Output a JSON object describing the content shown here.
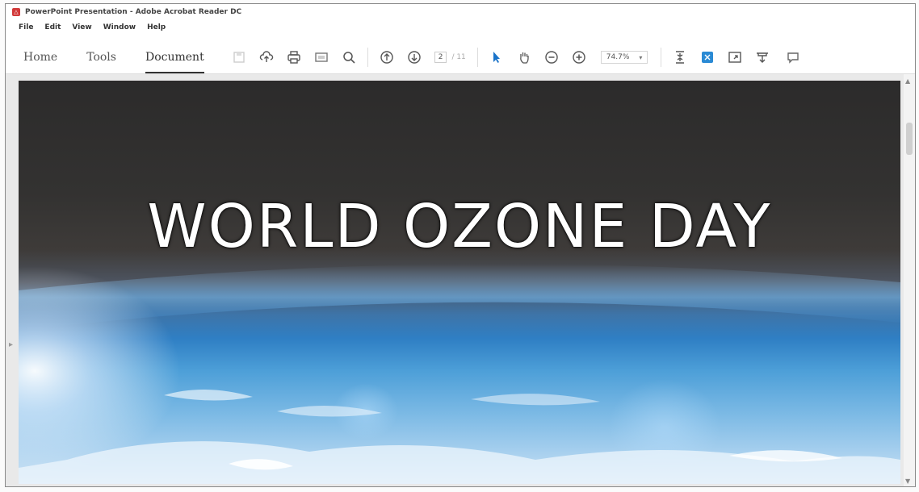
{
  "window": {
    "title": "PowerPoint Presentation - Adobe Acrobat Reader DC"
  },
  "menubar": {
    "items": [
      "File",
      "Edit",
      "View",
      "Window",
      "Help"
    ]
  },
  "toolbar": {
    "tabs": [
      {
        "label": "Home"
      },
      {
        "label": "Tools"
      },
      {
        "label": "Document",
        "active": true
      }
    ],
    "page_number": "2",
    "page_total": "/ 11",
    "zoom": "74.7%"
  },
  "slide": {
    "title": "WORLD OZONE DAY"
  },
  "colors": {
    "accent": "#1a73c9",
    "slide_title": "#ffffff"
  }
}
